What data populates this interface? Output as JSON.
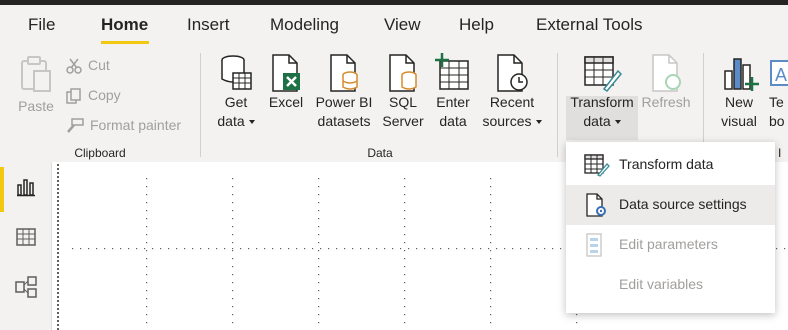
{
  "tabs": [
    "File",
    "Home",
    "Insert",
    "Modeling",
    "View",
    "Help",
    "External Tools"
  ],
  "clipboard": {
    "paste": "Paste",
    "cut": "Cut",
    "copy": "Copy",
    "format_painter": "Format painter",
    "group_label": "Clipboard"
  },
  "data_group": {
    "get_data": [
      "Get",
      "data"
    ],
    "excel": "Excel",
    "powerbi": [
      "Power BI",
      "datasets"
    ],
    "sql": [
      "SQL",
      "Server"
    ],
    "enter": [
      "Enter",
      "data"
    ],
    "recent": [
      "Recent",
      "sources"
    ],
    "group_label": "Data"
  },
  "queries": {
    "transform": [
      "Transform",
      "data"
    ],
    "refresh": "Refresh"
  },
  "insert_group": {
    "new_visual": [
      "New",
      "visual"
    ],
    "text_box_partial": [
      "Te",
      "bo"
    ],
    "group_label_partial": "I"
  },
  "dropdown": [
    {
      "label": "Transform data",
      "enabled": true
    },
    {
      "label": "Data source settings",
      "enabled": true
    },
    {
      "label": "Edit parameters",
      "enabled": false
    },
    {
      "label": "Edit variables",
      "enabled": false
    }
  ],
  "colors": {
    "accent": "#f2c811",
    "excel_green": "#1e7145",
    "orange": "#d58b2c",
    "teal": "#3b8c99"
  }
}
